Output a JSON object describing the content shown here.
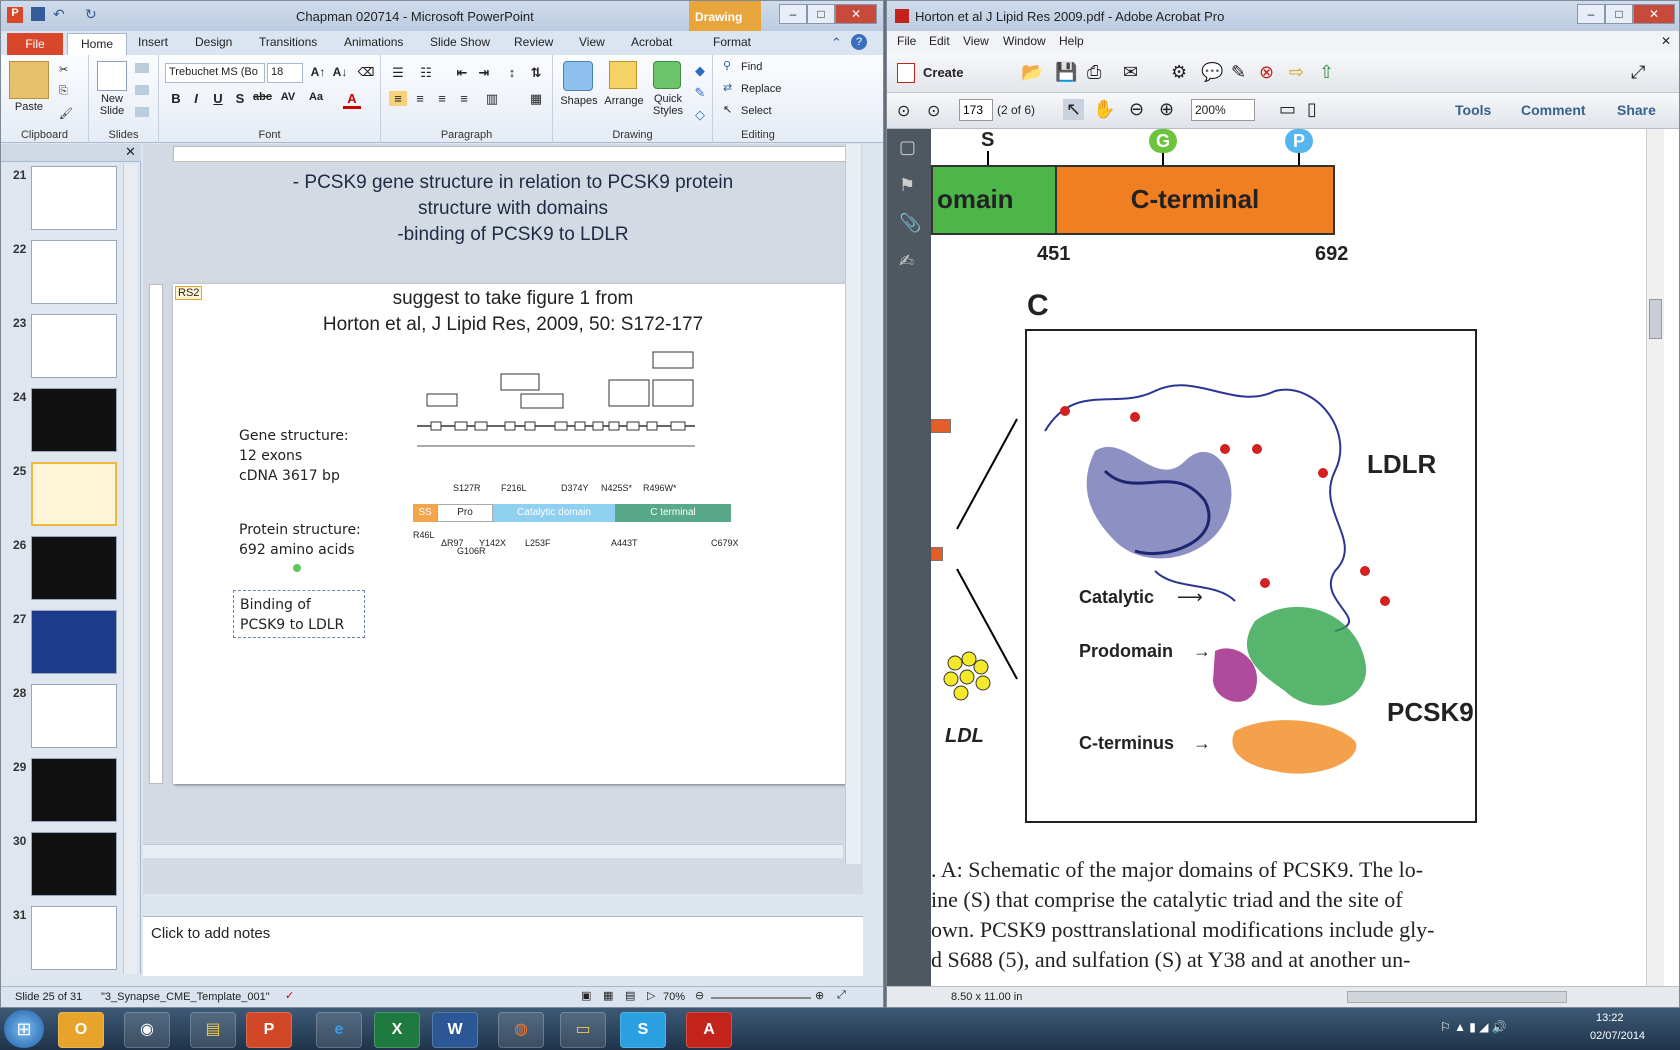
{
  "ppt": {
    "title": "Chapman 020714 - Microsoft PowerPoint",
    "context_tab": "Drawing ...",
    "tabs": [
      "File",
      "Home",
      "Insert",
      "Design",
      "Transitions",
      "Animations",
      "Slide Show",
      "Review",
      "View",
      "Acrobat",
      "Format"
    ],
    "ribbon": {
      "clipboard": {
        "paste": "Paste",
        "label": "Clipboard"
      },
      "slides": {
        "new_slide": "New Slide",
        "label": "Slides"
      },
      "font": {
        "name": "Trebuchet MS (Bo",
        "size": "18",
        "label": "Font"
      },
      "paragraph": {
        "label": "Paragraph"
      },
      "drawing": {
        "shapes": "Shapes",
        "arrange": "Arrange",
        "quick_styles": "Quick Styles",
        "label": "Drawing"
      },
      "editing": {
        "find": "Find",
        "replace": "Replace",
        "select": "Select",
        "label": "Editing"
      }
    },
    "thumbnails": [
      {
        "num": "21",
        "style": "white"
      },
      {
        "num": "22",
        "style": "white"
      },
      {
        "num": "23",
        "style": "white"
      },
      {
        "num": "24",
        "style": "dark"
      },
      {
        "num": "25",
        "style": "white",
        "selected": true
      },
      {
        "num": "26",
        "style": "dark"
      },
      {
        "num": "27",
        "style": "blue"
      },
      {
        "num": "28",
        "style": "white"
      },
      {
        "num": "29",
        "style": "dark"
      },
      {
        "num": "30",
        "style": "dark"
      },
      {
        "num": "31",
        "style": "white"
      }
    ],
    "slide_header": [
      "- PCSK9 gene structure  in relation  to PCSK9 protein",
      "structure  with domains",
      "-binding  of PCSK9 to LDLR"
    ],
    "slide": {
      "comment_tag": "RS2",
      "suggest_line1": "suggest to take  figure 1 from",
      "suggest_line2": "Horton et al, J Lipid Res, 2009, 50: S172-177",
      "gene_label": "Gene structure:",
      "gene_exons": "12 exons",
      "gene_cdna": "cDNA 3617 bp",
      "protein_label": "Protein structure:",
      "protein_aa": "692 amino acids",
      "binding": "Binding of PCSK9 to LDLR",
      "domain_labels": {
        "ss": "SS",
        "pro": "Pro",
        "cat": "Catalytic domain",
        "cterm": "C terminal"
      },
      "mutations_top": [
        "S127R",
        "F216L",
        "D374Y",
        "N425S*",
        "R496W*"
      ],
      "mutations_bottom": [
        "R46L",
        "ΔR97",
        "G106R",
        "Y142X",
        "L253F",
        "A443T",
        "C679X"
      ]
    },
    "notes": "Click to add notes",
    "status": {
      "slide": "Slide 25 of 31",
      "theme": "\"3_Synapse_CME_Template_001\"",
      "zoom": "70%"
    }
  },
  "acrobat": {
    "title": "Horton et al J Lipid Res 2009.pdf - Adobe Acrobat Pro",
    "menu": [
      "File",
      "Edit",
      "View",
      "Window",
      "Help"
    ],
    "create": "Create",
    "page_num": "173",
    "page_of": "(2 of 6)",
    "zoom": "200%",
    "panels": [
      "Tools",
      "Comment",
      "Share"
    ],
    "figure": {
      "residue_labels": [
        "S",
        "G",
        "P"
      ],
      "domain_left": "omain",
      "domain_right": "C-terminal",
      "pos_451": "451",
      "pos_692": "692",
      "panel_label": "C",
      "ldlr": "LDLR",
      "catalytic": "Catalytic",
      "prodomain": "Prodomain",
      "pcsk9": "PCSK9",
      "cterminus": "C-terminus",
      "ldl": "LDL"
    },
    "caption": [
      ". A: Schematic of the major domains of PCSK9. The lo-",
      "ine (S) that comprise the catalytic triad and the site of",
      "own. PCSK9 posttranslational modifications include gly-",
      "d S688 (5), and sulfation (S) at Y38 and at another un-"
    ],
    "page_size": "8.50 x 11.00 in"
  },
  "taskbar": {
    "time": "13:22",
    "date": "02/07/2014"
  },
  "colors": {
    "green_domain": "#4cb748",
    "orange_domain": "#f07f22",
    "ppt_file": "#d9472b",
    "taskbar": "#2a4560"
  }
}
